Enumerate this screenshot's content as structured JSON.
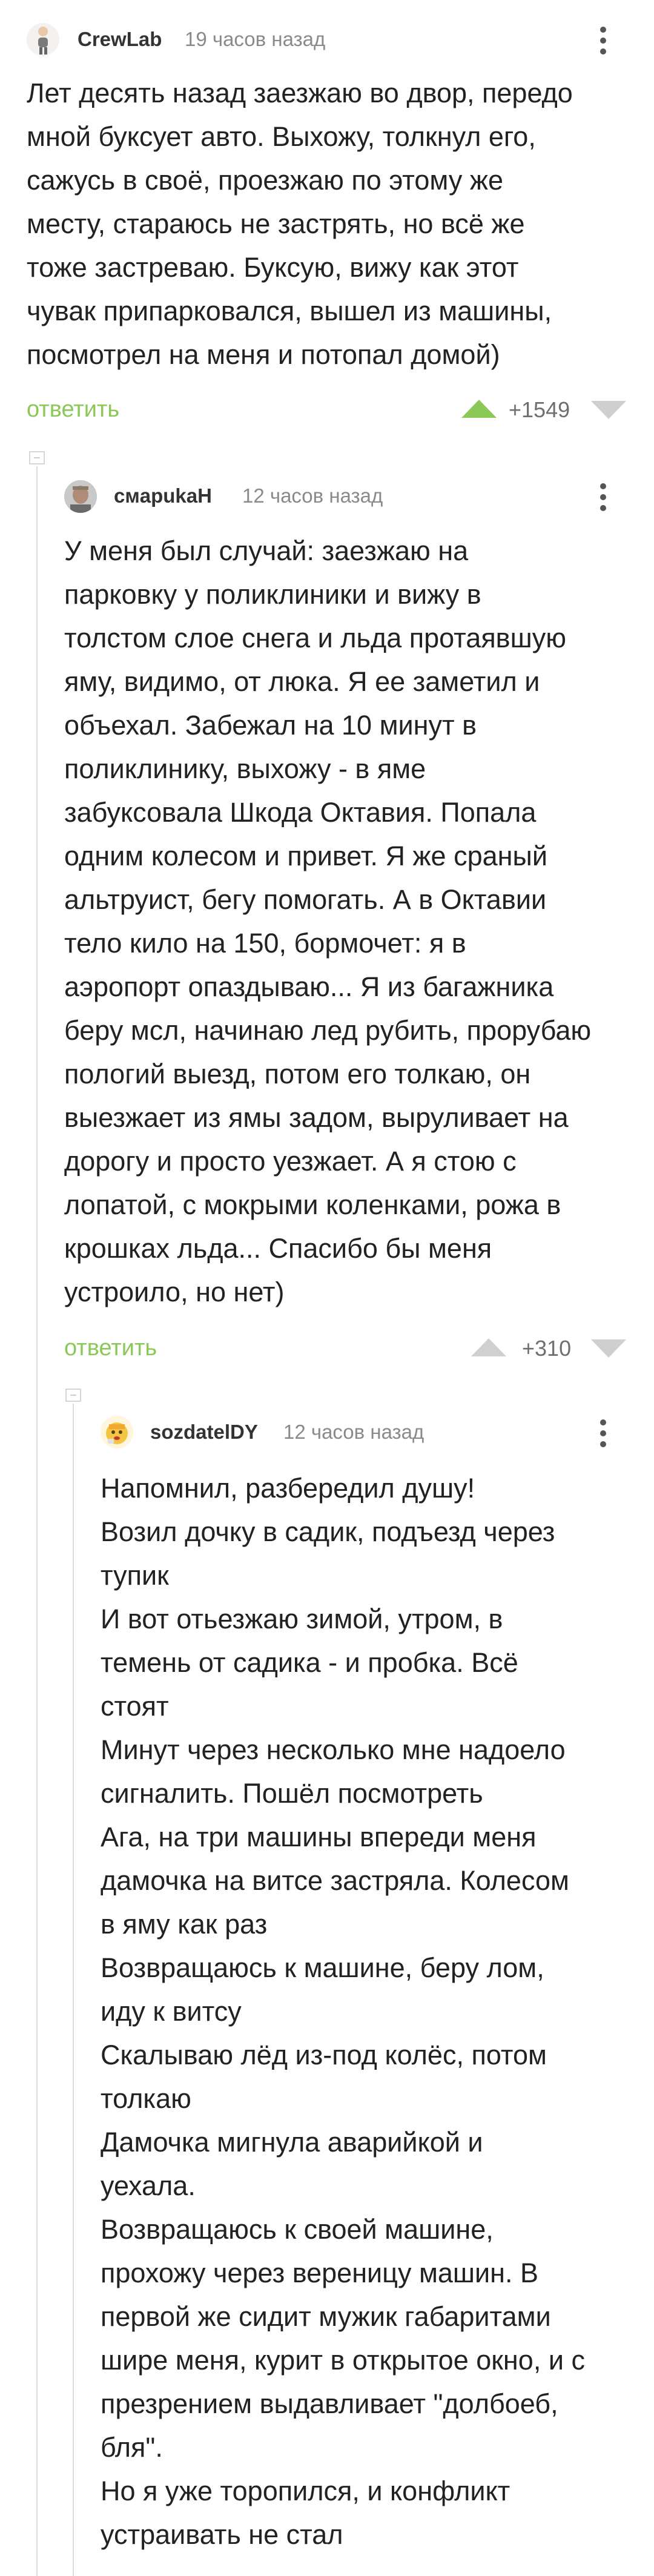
{
  "comments": [
    {
      "username": "CrewLab",
      "time": "19 часов назад",
      "lines": [
        "Лет десять назад заезжаю во двор, передо",
        "мной буксует авто. Выхожу, толкнул его,",
        "сажусь в своё, проезжаю по этому же",
        "месту, стараюсь не застрять, но всё же",
        "тоже застреваю. Буксую, вижу как этот",
        "чувак припарковался, вышел из машины,",
        "посмотрел на меня и потопал домой)"
      ],
      "reply_label": "ответить",
      "score": "+1549",
      "upvote_color": "#8ac858"
    },
    {
      "username": "cмapukaH",
      "time": "12 часов назад",
      "lines": [
        "У меня был случай: заезжаю на",
        "парковку у поликлиники и вижу в",
        "толстом слое снега и льда протаявшую",
        "яму, видимо, от люка. Я ее заметил и",
        "объехал. Забежал на 10 минут в",
        "поликлинику, выхожу - в яме",
        "забуксовала Шкода Октавия. Попала",
        "одним колесом и привет. Я же сраный",
        "альтруист, бегу помогать. А в Октавии",
        "тело кило на 150, бормочет: я в",
        "аэропорт опаздываю... Я из багажника",
        "беру мсл, начинаю лед рубить, прорубаю",
        "пологий выезд, потом его толкаю, он",
        "выезжает из ямы задом, выруливает на",
        "дорогу и просто уезжает. А я стою с",
        "лопатой, с мокрыми коленками, рожа в",
        "крошках льда... Спасибо бы меня",
        "устроило, но нет)"
      ],
      "reply_label": "ответить",
      "score": "+310",
      "upvote_color": "#d0d0d0"
    },
    {
      "username": "sozdatelDY",
      "time": "12 часов назад",
      "lines": [
        "Напомнил, разбередил душу!",
        "Возил дочку в садик, подъезд через",
        "тупик",
        "И вот отьезжаю зимой, утром, в",
        "темень от садика - и пробка. Всё",
        "стоят",
        "Минут через несколько мне надоело",
        "сигналить. Пошёл посмотреть",
        "Ага, на три машины впереди меня",
        "дамочка на витсе застряла. Колесом",
        "в яму как раз",
        "Возвращаюсь к машине, беру лом,",
        "иду к витсу",
        "Скалываю лёд из-под колёс, потом",
        "толкаю",
        "Дамочка мигнула аварийкой и",
        "уехала.",
        "Возвращаюсь к своей машине,",
        "прохожу через вереницу машин. В",
        "первой же сидит мужик габаритами",
        "шире меня, курит в открытое окно, и с",
        "презрением выдавливает \"долбоеб,",
        "бля\".",
        "Но я уже торопился, и конфликт",
        "устраивать не стал"
      ]
    }
  ]
}
